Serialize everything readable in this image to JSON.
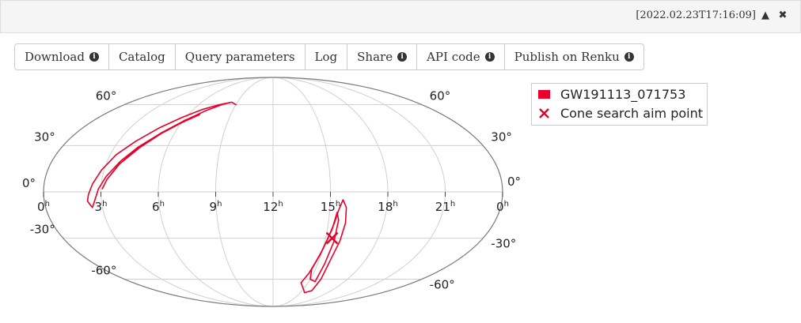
{
  "window": {
    "timestamp": "[2022.02.23T17:16:09]",
    "collapse_icon": "chevron-up-icon",
    "close_icon": "close-icon"
  },
  "toolbar": {
    "buttons": [
      {
        "label": "Download",
        "info": true
      },
      {
        "label": "Catalog",
        "info": false
      },
      {
        "label": "Query parameters",
        "info": false
      },
      {
        "label": "Log",
        "info": false
      },
      {
        "label": "Share",
        "info": true
      },
      {
        "label": "API code",
        "info": true
      },
      {
        "label": "Publish on Renku",
        "info": true
      }
    ]
  },
  "chart_data": {
    "type": "scatter",
    "projection": "mollweide",
    "grid": true,
    "ra_tick_labels": [
      {
        "ra": 180,
        "label": "0",
        "sup": "h"
      },
      {
        "ra": 135,
        "label": "21",
        "sup": "h"
      },
      {
        "ra": 90,
        "label": "18",
        "sup": "h"
      },
      {
        "ra": 45,
        "label": "15",
        "sup": "h"
      },
      {
        "ra": 0,
        "label": "12",
        "sup": "h"
      },
      {
        "ra": -45,
        "label": "9",
        "sup": "h"
      },
      {
        "ra": -90,
        "label": "6",
        "sup": "h"
      },
      {
        "ra": -135,
        "label": "3",
        "sup": "h"
      },
      {
        "ra": -180,
        "label": "0",
        "sup": "h"
      }
    ],
    "dec_tick_labels": [
      {
        "dec": 60,
        "label": "60°"
      },
      {
        "dec": 30,
        "label": "30°"
      },
      {
        "dec": 0,
        "label": "0°"
      },
      {
        "dec": -30,
        "label": "-30°"
      },
      {
        "dec": -60,
        "label": "-60°"
      }
    ],
    "legend_position": "top-right",
    "legend": [
      {
        "label": "GW191113_071753",
        "marker": "patch",
        "color": "#e8002a"
      },
      {
        "label": "Cone search aim point",
        "marker": "x",
        "color": "#e8002a"
      }
    ],
    "series": [
      {
        "name": "GW191113_071753",
        "color": "#e8002a",
        "contours": [
          [
            [
              -45,
              60
            ],
            [
              -52,
              62
            ],
            [
              -62,
              60
            ],
            [
              -75,
              55
            ],
            [
              -88,
              48
            ],
            [
              -102,
              39
            ],
            [
              -115,
              29
            ],
            [
              -124,
              20
            ],
            [
              -132,
              10
            ],
            [
              -137,
              2
            ],
            [
              -140,
              -5
            ],
            [
              -143,
              -10
            ],
            [
              -146,
              -6
            ],
            [
              -145,
              -2
            ],
            [
              -142,
              5
            ],
            [
              -137,
              14
            ],
            [
              -130,
              24
            ],
            [
              -120,
              33
            ],
            [
              -108,
              42
            ],
            [
              -94,
              50
            ],
            [
              -80,
              56
            ],
            [
              -65,
              60
            ],
            [
              -52,
              62
            ],
            [
              -45,
              60
            ]
          ],
          [
            [
              -78,
              52
            ],
            [
              -90,
              46
            ],
            [
              -104,
              37
            ],
            [
              -116,
              27
            ],
            [
              -125,
              17
            ],
            [
              -131,
              8
            ],
            [
              -134,
              2
            ],
            [
              -131,
              8
            ],
            [
              -124,
              18
            ],
            [
              -113,
              29
            ],
            [
              -100,
              40
            ],
            [
              -88,
              48
            ],
            [
              -78,
              52
            ]
          ],
          [
            [
              55,
              -5
            ],
            [
              52,
              -12
            ],
            [
              50,
              -20
            ],
            [
              47,
              -30
            ],
            [
              44,
              -42
            ],
            [
              40,
              -55
            ],
            [
              36,
              -63
            ],
            [
              44,
              -68
            ],
            [
              52,
              -72
            ],
            [
              60,
              -70
            ],
            [
              58,
              -60
            ],
            [
              56,
              -45
            ],
            [
              58,
              -32
            ],
            [
              59,
              -20
            ],
            [
              58,
              -10
            ],
            [
              55,
              -5
            ]
          ],
          [
            [
              51,
              -13
            ],
            [
              49,
              -24
            ],
            [
              45,
              -38
            ],
            [
              41,
              -52
            ],
            [
              45,
              -60
            ],
            [
              53,
              -62
            ],
            [
              52,
              -48
            ],
            [
              53,
              -32
            ],
            [
              53,
              -18
            ],
            [
              51,
              -13
            ]
          ]
        ]
      }
    ],
    "aim_point": {
      "ra": 50.6,
      "dec": -30
    }
  }
}
